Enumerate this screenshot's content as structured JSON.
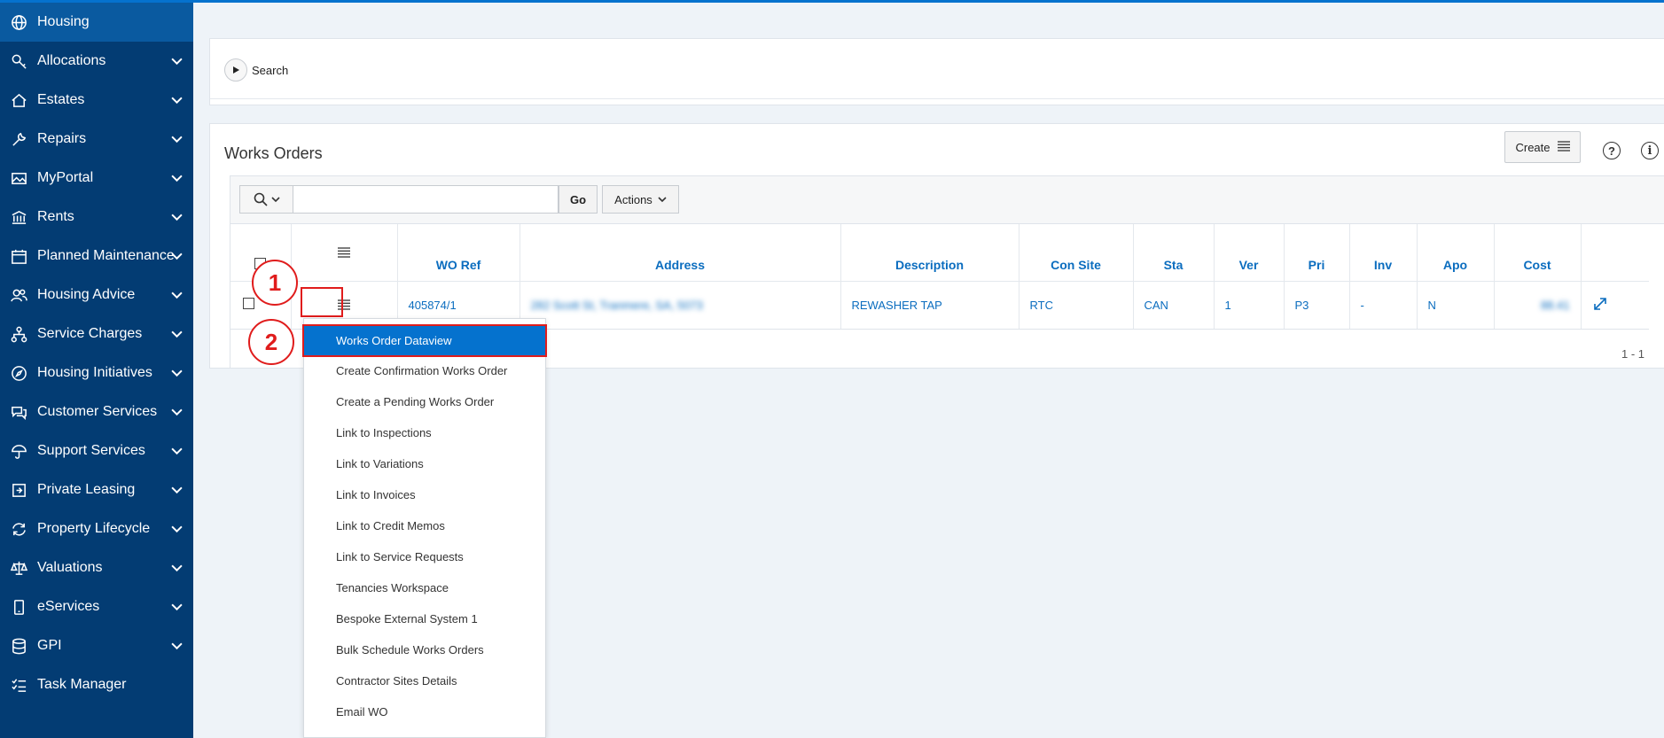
{
  "sidebar": {
    "items": [
      {
        "label": "Housing",
        "icon": "globe-icon",
        "active": true,
        "has_chevron": false
      },
      {
        "label": "Allocations",
        "icon": "key-icon",
        "has_chevron": true
      },
      {
        "label": "Estates",
        "icon": "home-icon",
        "has_chevron": true
      },
      {
        "label": "Repairs",
        "icon": "wrench-icon",
        "has_chevron": true
      },
      {
        "label": "MyPortal",
        "icon": "image-icon",
        "has_chevron": true
      },
      {
        "label": "Rents",
        "icon": "bank-icon",
        "has_chevron": true
      },
      {
        "label": "Planned Maintenance",
        "icon": "calendar-icon",
        "has_chevron": true
      },
      {
        "label": "Housing Advice",
        "icon": "users-icon",
        "has_chevron": true
      },
      {
        "label": "Service Charges",
        "icon": "sitemap-icon",
        "has_chevron": true
      },
      {
        "label": "Housing Initiatives",
        "icon": "compass-icon",
        "has_chevron": true
      },
      {
        "label": "Customer Services",
        "icon": "chat-icon",
        "has_chevron": true
      },
      {
        "label": "Support Services",
        "icon": "umbrella-icon",
        "has_chevron": true
      },
      {
        "label": "Private Leasing",
        "icon": "sign-in-icon",
        "has_chevron": true
      },
      {
        "label": "Property Lifecycle",
        "icon": "refresh-icon",
        "has_chevron": true
      },
      {
        "label": "Valuations",
        "icon": "balance-icon",
        "has_chevron": true
      },
      {
        "label": "eServices",
        "icon": "mobile-icon",
        "has_chevron": true
      },
      {
        "label": "GPI",
        "icon": "database-icon",
        "has_chevron": true
      },
      {
        "label": "Task Manager",
        "icon": "checklist-icon",
        "has_chevron": false
      }
    ]
  },
  "search_region": {
    "label": "Search"
  },
  "works_orders": {
    "title": "Works Orders",
    "create_label": "Create",
    "help_glyph": "?",
    "info_glyph": "i",
    "toolbar": {
      "search_placeholder": "",
      "go_label": "Go",
      "actions_label": "Actions"
    },
    "columns": [
      "WO Ref",
      "Address",
      "Description",
      "Con Site",
      "Sta",
      "Ver",
      "Pri",
      "Inv",
      "Apo",
      "Cost"
    ],
    "rows": [
      {
        "wo_ref": "405874/1",
        "address": "282 Scott St, Tranmere, SA, 5073",
        "description": "REWASHER TAP",
        "con_site": "RTC",
        "sta": "CAN",
        "ver": "1",
        "pri": "P3",
        "inv": "-",
        "apo": "N",
        "cost": "88.41"
      }
    ],
    "pagination": "1 - 1"
  },
  "markers": {
    "one": "1",
    "two": "2"
  },
  "row_menu": {
    "items": [
      "Works Order Dataview",
      "Create Confirmation Works Order",
      "Create a Pending Works Order",
      "Link to Inspections",
      "Link to Variations",
      "Link to Invoices",
      "Link to Credit Memos",
      "Link to Service Requests",
      "Tenancies Workspace",
      "Bespoke External System 1",
      "Bulk Schedule Works Orders",
      "Contractor Sites Details",
      "Email WO"
    ],
    "selected_index": 0
  },
  "colors": {
    "sidebar_bg": "#033c73",
    "accent": "#0572ce",
    "link": "#0b6dbf",
    "highlight": "#e01c1c"
  }
}
